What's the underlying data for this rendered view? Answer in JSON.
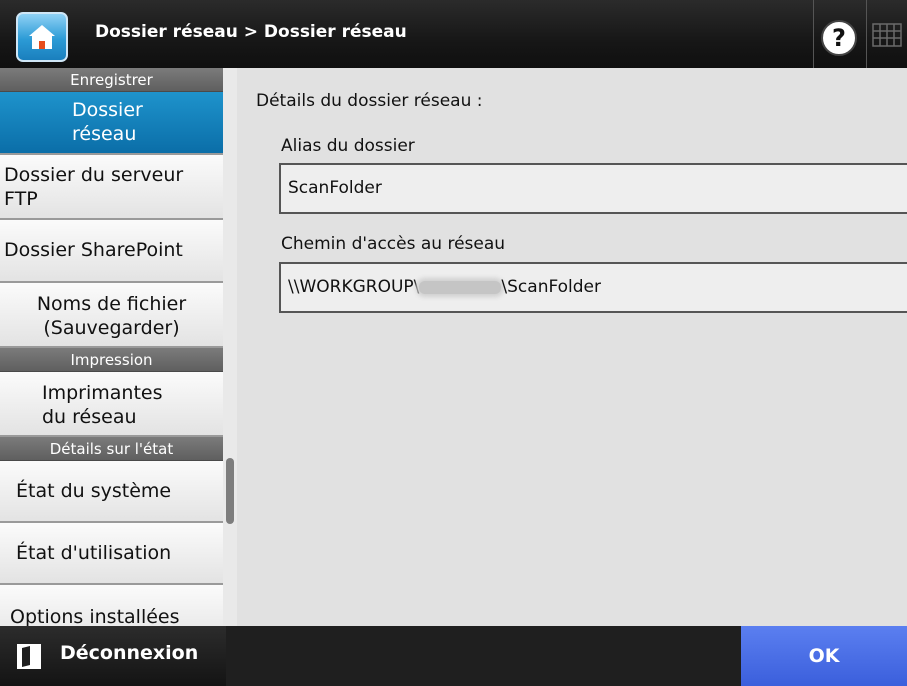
{
  "header": {
    "title": "Dossier réseau > Dossier réseau",
    "home_icon": "home-icon",
    "help_icon": "question-circle-icon",
    "keyboard_icon": "keyboard-icon"
  },
  "sidebar": {
    "sections": [
      {
        "header": "Enregistrer",
        "items": [
          {
            "label": "Dossier\nréseau",
            "active": true
          },
          {
            "label": "Dossier du serveur\nFTP",
            "active": false
          },
          {
            "label": "Dossier SharePoint",
            "active": false
          },
          {
            "label": "Noms de fichier\n(Sauvegarder)",
            "active": false
          }
        ]
      },
      {
        "header": "Impression",
        "items": [
          {
            "label": "Imprimantes\ndu réseau",
            "active": false
          }
        ]
      },
      {
        "header": "Détails sur l'état",
        "items": [
          {
            "label": "État du système",
            "active": false
          },
          {
            "label": "État d'utilisation",
            "active": false
          },
          {
            "label": "Options installées",
            "active": false
          }
        ]
      }
    ]
  },
  "main": {
    "heading": "Détails du dossier réseau :",
    "alias_label": "Alias du dossier",
    "alias_value": "ScanFolder",
    "path_label": "Chemin d'accès au réseau",
    "path_prefix": "\\\\WORKGROUP\\",
    "path_suffix": "\\ScanFolder"
  },
  "footer": {
    "logout_label": "Déconnexion",
    "logout_icon": "logout-door-icon",
    "ok_label": "OK"
  },
  "colors": {
    "accent_active": "#0b6ea8",
    "ok_button": "#4a6fe6",
    "header_bg": "#1a1a1a"
  }
}
